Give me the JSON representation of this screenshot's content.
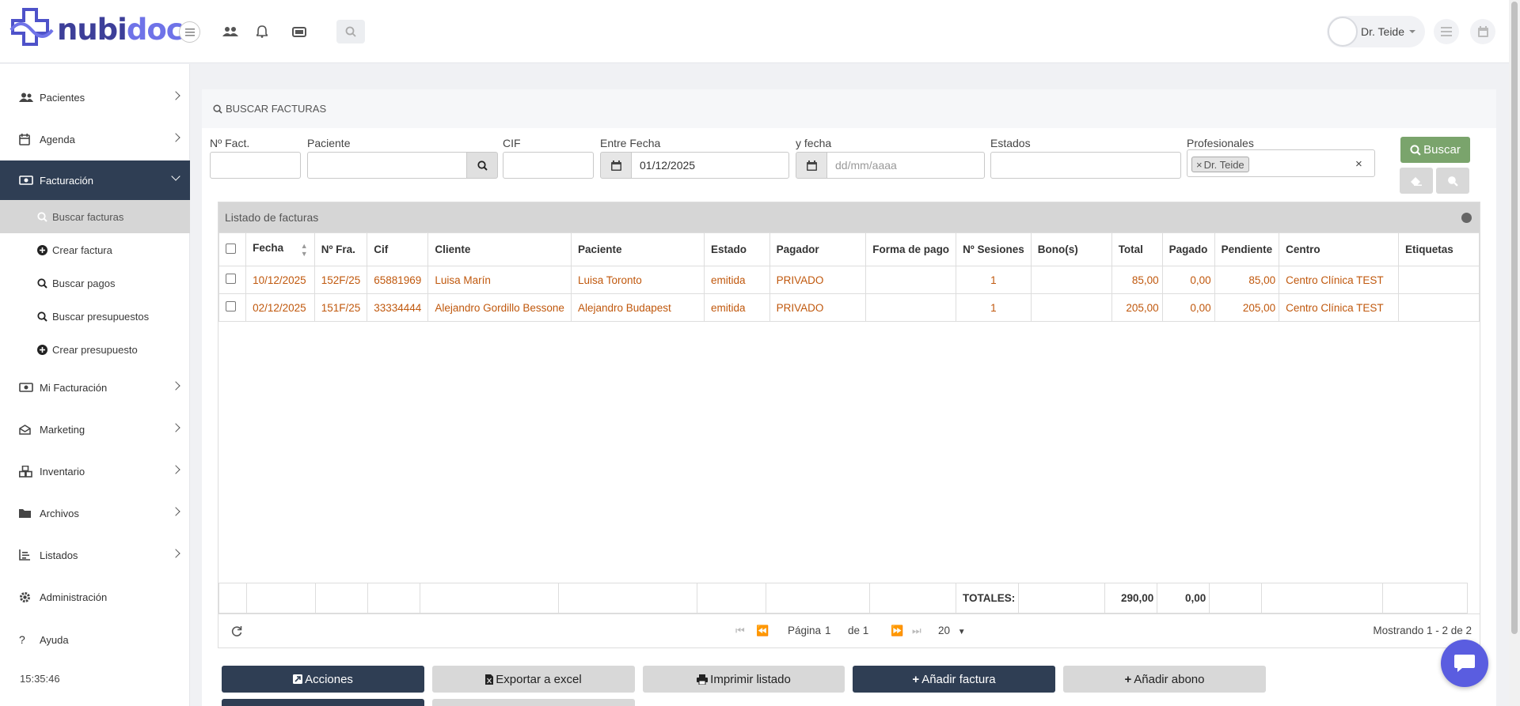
{
  "brand": {
    "name_part1": "nubi",
    "name_part2": "doc"
  },
  "header": {
    "search_placeholder": "",
    "user_name": "Dr. Teide"
  },
  "sidebar": {
    "items": [
      {
        "label": "Pacientes",
        "icon": "users-icon"
      },
      {
        "label": "Agenda",
        "icon": "calendar-icon"
      },
      {
        "label": "Facturación",
        "icon": "money-icon"
      },
      {
        "label": "Mi Facturación",
        "icon": "money-icon"
      },
      {
        "label": "Marketing",
        "icon": "envelope-icon"
      },
      {
        "label": "Inventario",
        "icon": "cubes-icon"
      },
      {
        "label": "Archivos",
        "icon": "folder-icon"
      },
      {
        "label": "Listados",
        "icon": "chart-icon"
      },
      {
        "label": "Administración",
        "icon": "gear-icon"
      },
      {
        "label": "Ayuda",
        "icon": "question-icon"
      }
    ],
    "subitems": [
      {
        "label": "Buscar facturas",
        "icon": "search-icon"
      },
      {
        "label": "Crear factura",
        "icon": "plus-circle-icon"
      },
      {
        "label": "Buscar pagos",
        "icon": "search-icon"
      },
      {
        "label": "Buscar presupuestos",
        "icon": "search-icon"
      },
      {
        "label": "Crear presupuesto",
        "icon": "plus-circle-icon"
      }
    ],
    "clock": "15:35:46"
  },
  "search_panel": {
    "title": "BUSCAR FACTURAS",
    "fields": {
      "nfact": {
        "label": "Nº Fact.",
        "value": ""
      },
      "paciente": {
        "label": "Paciente",
        "value": ""
      },
      "cif": {
        "label": "CIF",
        "value": ""
      },
      "entre_fecha": {
        "label": "Entre Fecha",
        "value": "01/12/2025"
      },
      "y_fecha": {
        "label": "y fecha",
        "placeholder": "dd/mm/aaaa"
      },
      "estados": {
        "label": "Estados",
        "value": ""
      },
      "profesionales": {
        "label": "Profesionales",
        "tag": "Dr. Teide",
        "tag_remove": "×",
        "clear": "×"
      }
    },
    "search_button": "Buscar"
  },
  "grid": {
    "caption": "Listado de facturas",
    "columns": [
      "Fecha",
      "Nº Fra.",
      "Cif",
      "Cliente",
      "Paciente",
      "Estado",
      "Pagador",
      "Forma de pago",
      "Nº Sesiones",
      "Bono(s)",
      "Total",
      "Pagado",
      "Pendiente",
      "Centro",
      "Etiquetas"
    ],
    "rows": [
      {
        "fecha": "10/12/2025",
        "nfra": "152F/25",
        "cif": "65881969",
        "cliente": "Luisa Marín",
        "paciente": "Luisa Toronto",
        "estado": "emitida",
        "pagador": "PRIVADO",
        "forma_pago": "",
        "sesiones": "1",
        "bonos": "",
        "total": "85,00",
        "pagado": "0,00",
        "pendiente": "85,00",
        "centro": "Centro Clínica TEST",
        "etiquetas": ""
      },
      {
        "fecha": "02/12/2025",
        "nfra": "151F/25",
        "cif": "33334444",
        "cliente": "Alejandro Gordillo Bessone",
        "paciente": "Alejandro Budapest",
        "estado": "emitida",
        "pagador": "PRIVADO",
        "forma_pago": "",
        "sesiones": "1",
        "bonos": "",
        "total": "205,00",
        "pagado": "0,00",
        "pendiente": "205,00",
        "centro": "Centro Clínica TEST",
        "etiquetas": ""
      }
    ],
    "totals": {
      "label": "TOTALES:",
      "total": "290,00",
      "pagado": "0,00"
    },
    "pager": {
      "page_label": "Página",
      "page": "1",
      "of_label": "de 1",
      "page_size": "20",
      "showing": "Mostrando 1 - 2 de 2"
    }
  },
  "actions": [
    "Acciones",
    "Exportar a excel",
    "Imprimir listado",
    "Añadir factura",
    "Añadir abono"
  ],
  "colors": {
    "primary_dark": "#2f3e54",
    "link_orange": "#c0580d",
    "buscar_green": "#7aa46c",
    "chat_blue": "#5a5de0"
  }
}
